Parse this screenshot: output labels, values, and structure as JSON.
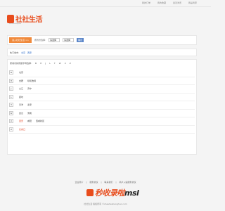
{
  "topbar": {
    "links": [
      "我的订单",
      "我的收藏",
      "最近浏览",
      "我是商家"
    ]
  },
  "logo": {
    "text": "社社生活",
    "subtitle": "shesheshenghuo"
  },
  "search": {
    "enter_button": "进入社社生活 >>",
    "label": "按省份选择:",
    "province": "请选择",
    "city": "请选择",
    "confirm_button": "确定"
  },
  "hot": {
    "label": "热门城市:",
    "cities": [
      "北京",
      "西安"
    ]
  },
  "citylist": {
    "letters_label": "按城市拼音首字母选择:",
    "letters": [
      "B",
      "H",
      "J",
      "L",
      "T",
      "W",
      "X",
      "Z"
    ],
    "rows": [
      {
        "letter": "B",
        "cities": [
          {
            "name": "北京",
            "highlight": false
          }
        ]
      },
      {
        "letter": "H",
        "cities": [
          {
            "name": "合肥",
            "highlight": false
          },
          {
            "name": "呼和浩特",
            "highlight": false
          }
        ]
      },
      {
        "letter": "J",
        "cities": [
          {
            "name": "九江",
            "highlight": false
          },
          {
            "name": "济宁",
            "highlight": false
          }
        ]
      },
      {
        "letter": "L",
        "cities": [
          {
            "name": "廊坊",
            "highlight": false
          }
        ]
      },
      {
        "letter": "T",
        "cities": [
          {
            "name": "天津",
            "highlight": false
          },
          {
            "name": "泰安",
            "highlight": false
          }
        ]
      },
      {
        "letter": "W",
        "cities": [
          {
            "name": "武汉",
            "highlight": false
          },
          {
            "name": "渭南",
            "highlight": false
          }
        ]
      },
      {
        "letter": "X",
        "cities": [
          {
            "name": "西安",
            "highlight": true
          },
          {
            "name": "咸阳",
            "highlight": false
          },
          {
            "name": "西咸新区",
            "highlight": false
          }
        ]
      },
      {
        "letter": "Z",
        "cities": [
          {
            "name": "长春口",
            "highlight": true
          }
        ]
      }
    ]
  },
  "footer": {
    "links": [
      "企业简介",
      "服务协议",
      "联系我们",
      "商户入驻服务协议"
    ],
    "watermark_main": "秒收录啦",
    "watermark_suffix": "msl",
    "copyright": "社社生活 版权所有 ©shesheshenghuo.com"
  },
  "colors": {
    "accent": "#e84c1c",
    "orange_button": "#f08a3c",
    "blue_button": "#5b86c9",
    "link": "#2a6ac8"
  }
}
